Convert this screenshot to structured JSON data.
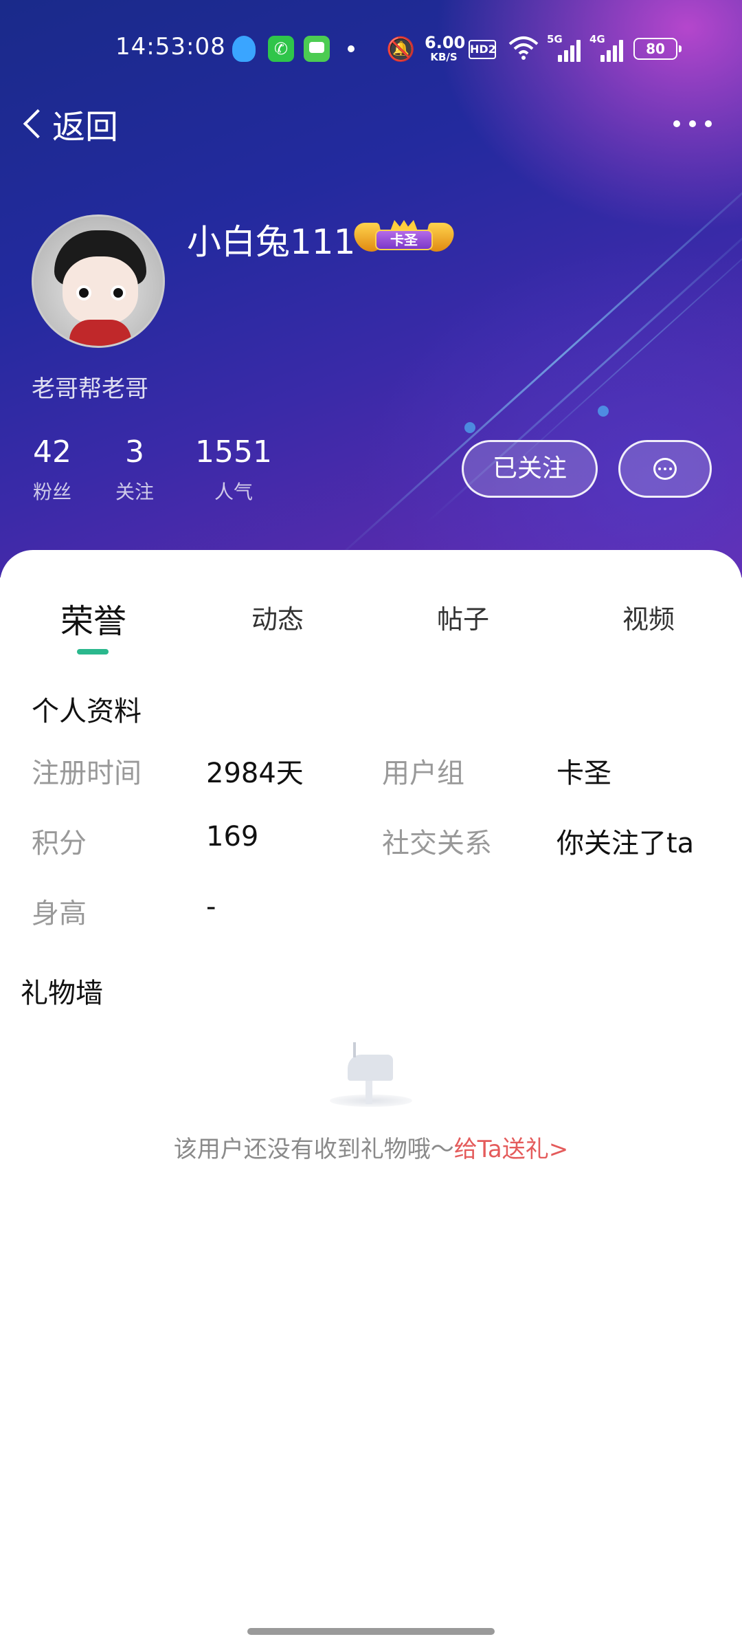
{
  "status_bar": {
    "time": "14:53:08",
    "net_speed_value": "6.00",
    "net_speed_unit": "KB/S",
    "hd_label": "HD2",
    "signal_1_label": "5G",
    "signal_2_label": "4G",
    "battery": "80",
    "icons": [
      "qq-icon",
      "phone-icon",
      "message-icon",
      "mute-icon",
      "wifi-icon",
      "signal-icon",
      "battery-icon"
    ]
  },
  "nav": {
    "back_label": "返回",
    "more_icon": "more-dots-icon"
  },
  "profile": {
    "username": "小白兔111",
    "rank_badge": "卡圣",
    "motto": "老哥帮老哥",
    "stats": [
      {
        "value": "42",
        "label": "粉丝"
      },
      {
        "value": "3",
        "label": "关注"
      },
      {
        "value": "1551",
        "label": "人气"
      }
    ],
    "follow_button": "已关注",
    "chat_icon": "chat-bubble-icon"
  },
  "tabs": [
    {
      "label": "荣誉",
      "active": true
    },
    {
      "label": "动态",
      "active": false
    },
    {
      "label": "帖子",
      "active": false
    },
    {
      "label": "视频",
      "active": false
    }
  ],
  "personal_info": {
    "title": "个人资料",
    "fields": [
      {
        "label": "注册时间",
        "value": "2984天"
      },
      {
        "label": "用户组",
        "value": "卡圣"
      },
      {
        "label": "积分",
        "value": "169"
      },
      {
        "label": "社交关系",
        "value": "你关注了ta"
      },
      {
        "label": "身高",
        "value": "-"
      }
    ]
  },
  "gift_wall": {
    "title": "礼物墙",
    "empty_text": "该用户还没有收到礼物哦～",
    "send_gift_link": "给Ta送礼>",
    "empty_icon": "mailbox-icon"
  },
  "colors": {
    "accent": "#2bb88d",
    "link": "#e45b5b",
    "hero_start": "#1a2a8a",
    "hero_end": "#6a2cb0"
  }
}
